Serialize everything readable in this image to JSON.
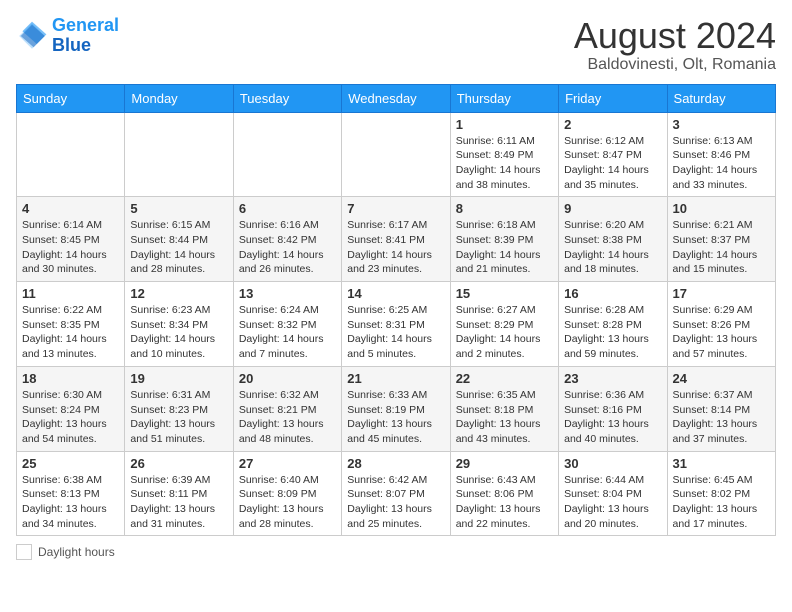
{
  "header": {
    "logo_line1": "General",
    "logo_line2": "Blue",
    "month_year": "August 2024",
    "location": "Baldovinesti, Olt, Romania"
  },
  "days_of_week": [
    "Sunday",
    "Monday",
    "Tuesday",
    "Wednesday",
    "Thursday",
    "Friday",
    "Saturday"
  ],
  "weeks": [
    [
      {
        "day": "",
        "info": ""
      },
      {
        "day": "",
        "info": ""
      },
      {
        "day": "",
        "info": ""
      },
      {
        "day": "",
        "info": ""
      },
      {
        "day": "1",
        "info": "Sunrise: 6:11 AM\nSunset: 8:49 PM\nDaylight: 14 hours and 38 minutes."
      },
      {
        "day": "2",
        "info": "Sunrise: 6:12 AM\nSunset: 8:47 PM\nDaylight: 14 hours and 35 minutes."
      },
      {
        "day": "3",
        "info": "Sunrise: 6:13 AM\nSunset: 8:46 PM\nDaylight: 14 hours and 33 minutes."
      }
    ],
    [
      {
        "day": "4",
        "info": "Sunrise: 6:14 AM\nSunset: 8:45 PM\nDaylight: 14 hours and 30 minutes."
      },
      {
        "day": "5",
        "info": "Sunrise: 6:15 AM\nSunset: 8:44 PM\nDaylight: 14 hours and 28 minutes."
      },
      {
        "day": "6",
        "info": "Sunrise: 6:16 AM\nSunset: 8:42 PM\nDaylight: 14 hours and 26 minutes."
      },
      {
        "day": "7",
        "info": "Sunrise: 6:17 AM\nSunset: 8:41 PM\nDaylight: 14 hours and 23 minutes."
      },
      {
        "day": "8",
        "info": "Sunrise: 6:18 AM\nSunset: 8:39 PM\nDaylight: 14 hours and 21 minutes."
      },
      {
        "day": "9",
        "info": "Sunrise: 6:20 AM\nSunset: 8:38 PM\nDaylight: 14 hours and 18 minutes."
      },
      {
        "day": "10",
        "info": "Sunrise: 6:21 AM\nSunset: 8:37 PM\nDaylight: 14 hours and 15 minutes."
      }
    ],
    [
      {
        "day": "11",
        "info": "Sunrise: 6:22 AM\nSunset: 8:35 PM\nDaylight: 14 hours and 13 minutes."
      },
      {
        "day": "12",
        "info": "Sunrise: 6:23 AM\nSunset: 8:34 PM\nDaylight: 14 hours and 10 minutes."
      },
      {
        "day": "13",
        "info": "Sunrise: 6:24 AM\nSunset: 8:32 PM\nDaylight: 14 hours and 7 minutes."
      },
      {
        "day": "14",
        "info": "Sunrise: 6:25 AM\nSunset: 8:31 PM\nDaylight: 14 hours and 5 minutes."
      },
      {
        "day": "15",
        "info": "Sunrise: 6:27 AM\nSunset: 8:29 PM\nDaylight: 14 hours and 2 minutes."
      },
      {
        "day": "16",
        "info": "Sunrise: 6:28 AM\nSunset: 8:28 PM\nDaylight: 13 hours and 59 minutes."
      },
      {
        "day": "17",
        "info": "Sunrise: 6:29 AM\nSunset: 8:26 PM\nDaylight: 13 hours and 57 minutes."
      }
    ],
    [
      {
        "day": "18",
        "info": "Sunrise: 6:30 AM\nSunset: 8:24 PM\nDaylight: 13 hours and 54 minutes."
      },
      {
        "day": "19",
        "info": "Sunrise: 6:31 AM\nSunset: 8:23 PM\nDaylight: 13 hours and 51 minutes."
      },
      {
        "day": "20",
        "info": "Sunrise: 6:32 AM\nSunset: 8:21 PM\nDaylight: 13 hours and 48 minutes."
      },
      {
        "day": "21",
        "info": "Sunrise: 6:33 AM\nSunset: 8:19 PM\nDaylight: 13 hours and 45 minutes."
      },
      {
        "day": "22",
        "info": "Sunrise: 6:35 AM\nSunset: 8:18 PM\nDaylight: 13 hours and 43 minutes."
      },
      {
        "day": "23",
        "info": "Sunrise: 6:36 AM\nSunset: 8:16 PM\nDaylight: 13 hours and 40 minutes."
      },
      {
        "day": "24",
        "info": "Sunrise: 6:37 AM\nSunset: 8:14 PM\nDaylight: 13 hours and 37 minutes."
      }
    ],
    [
      {
        "day": "25",
        "info": "Sunrise: 6:38 AM\nSunset: 8:13 PM\nDaylight: 13 hours and 34 minutes."
      },
      {
        "day": "26",
        "info": "Sunrise: 6:39 AM\nSunset: 8:11 PM\nDaylight: 13 hours and 31 minutes."
      },
      {
        "day": "27",
        "info": "Sunrise: 6:40 AM\nSunset: 8:09 PM\nDaylight: 13 hours and 28 minutes."
      },
      {
        "day": "28",
        "info": "Sunrise: 6:42 AM\nSunset: 8:07 PM\nDaylight: 13 hours and 25 minutes."
      },
      {
        "day": "29",
        "info": "Sunrise: 6:43 AM\nSunset: 8:06 PM\nDaylight: 13 hours and 22 minutes."
      },
      {
        "day": "30",
        "info": "Sunrise: 6:44 AM\nSunset: 8:04 PM\nDaylight: 13 hours and 20 minutes."
      },
      {
        "day": "31",
        "info": "Sunrise: 6:45 AM\nSunset: 8:02 PM\nDaylight: 13 hours and 17 minutes."
      }
    ]
  ],
  "footer": {
    "daylight_label": "Daylight hours"
  }
}
